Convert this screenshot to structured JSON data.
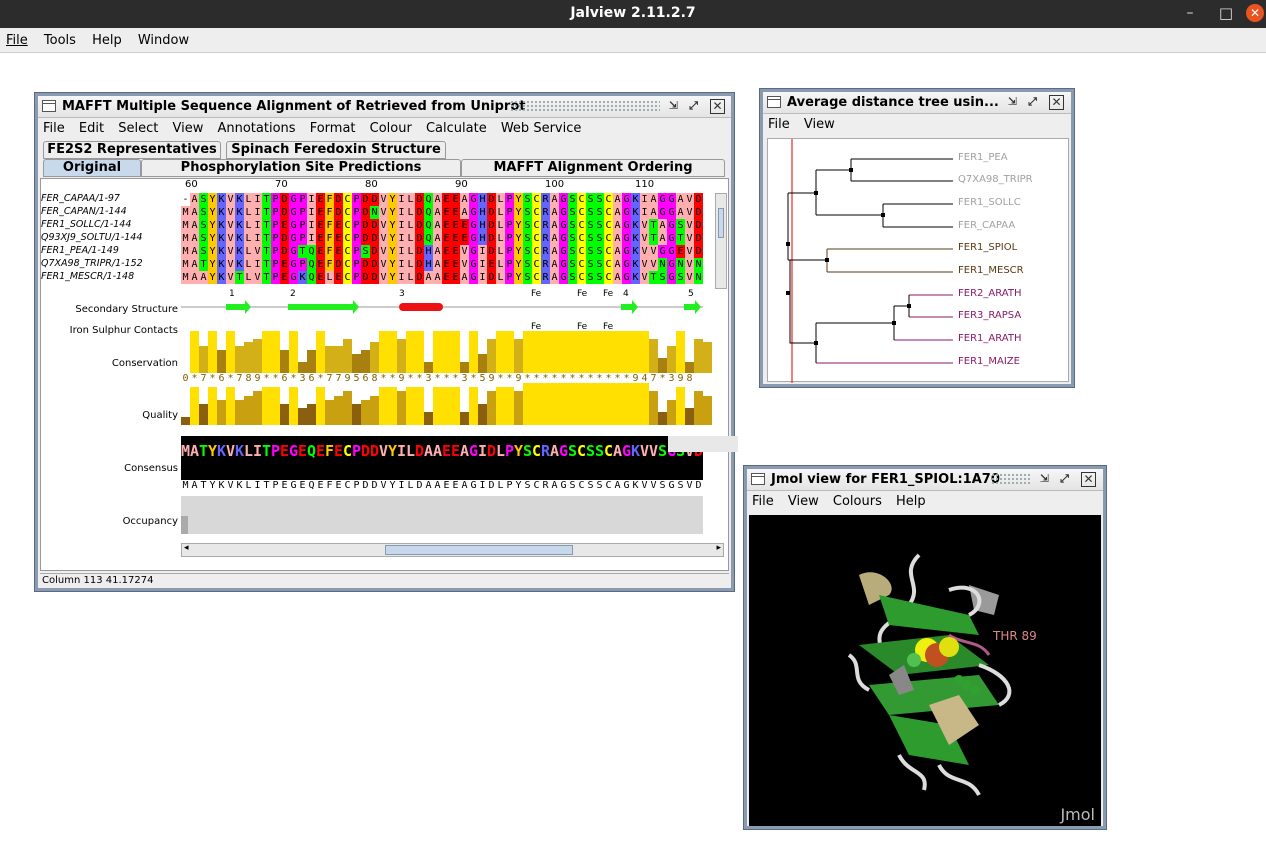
{
  "app": {
    "title": "Jalview 2.11.2.7",
    "menu": [
      "File",
      "Tools",
      "Help",
      "Window"
    ],
    "close_glyph": "✕",
    "minimize_glyph": "–",
    "maximize_glyph": "□"
  },
  "alignment_window": {
    "title": "MAFFT Multiple Sequence Alignment of Retrieved from Uniprot",
    "menu": [
      "File",
      "Edit",
      "Select",
      "View",
      "Annotations",
      "Format",
      "Colour",
      "Calculate",
      "Web Service"
    ],
    "tabs_row1": [
      "FE2S2 Representatives",
      "Spinach Feredoxin Structure"
    ],
    "tabs_row2": [
      "Original",
      "Phosphorylation Site Predictions",
      "MAFFT Alignment Ordering"
    ],
    "ruler": [
      "60",
      "70",
      "80",
      "90",
      "100",
      "110"
    ],
    "sequences": [
      {
        "name": "FER_CAPAA/1-97",
        "seq": "-ASYKVKLITPDGPIEFDCPDDVYILDQAEEAGHDLPYSCRAGSCSSCAGKIAGGAVD"
      },
      {
        "name": "FER_CAPAN/1-144",
        "seq": "MASYKVKLITPDGPIEFDCPDNVYILDQAEEAGHDLPYSCRAGSCSSCAGKIAGGAVD"
      },
      {
        "name": "FER1_SOLLC/1-144",
        "seq": "MASYKVKLITPEGPIEFECPDDVYILDQAEEEGHDLPYSCRAGSCSSCAGKVTAGSVD"
      },
      {
        "name": "Q93XJ9_SOLTU/1-144",
        "seq": "MASYKVKLITPDGPIEFECPDDVYILDQAEEEGHDLPYSCRAGSCSSCAGKVTAGTVD"
      },
      {
        "name": "FER1_PEA/1-149",
        "seq": "MASYKVKLVTPDGTQEFECPSDVYILDHAEEVGIDLPYSCRAGSCSSCAGKVVGGEVD"
      },
      {
        "name": "Q7XA98_TRIPR/1-152",
        "seq": "MATYKVKLITPEGPQEFDCPDDVYILDHAEEVGIELPYSCRAGSCSSCAGKVVNGNVN"
      },
      {
        "name": "FER1_MESCR/1-148",
        "seq": "MAAYKVTLVTPEGKQELECPDDVYILDAAEEAGIDLPYSCRAGSCSSCAGKVTSGSVN"
      }
    ],
    "annotation_labels": [
      "Secondary Structure",
      "Iron Sulphur Contacts",
      "Conservation",
      "Quality",
      "Consensus",
      "Occupancy"
    ],
    "ss_labels": [
      "1",
      "2",
      "3",
      "4",
      "5"
    ],
    "fe_labels": [
      "Fe",
      "Fe",
      "Fe"
    ],
    "conservation_string": "0*7*6*789**6*36*779568**9**3***3*59**9************947*398",
    "conservation_scores": [
      0,
      11,
      7,
      11,
      6,
      11,
      7,
      8,
      9,
      11,
      11,
      6,
      11,
      3,
      6,
      11,
      7,
      7,
      9,
      5,
      6,
      8,
      11,
      11,
      9,
      11,
      11,
      3,
      11,
      11,
      11,
      3,
      11,
      5,
      9,
      11,
      11,
      9,
      11,
      11,
      11,
      11,
      11,
      11,
      11,
      11,
      11,
      11,
      11,
      11,
      11,
      11,
      9,
      4,
      7,
      11,
      3,
      9,
      8
    ],
    "quality_scores": [
      2,
      9,
      5,
      9,
      6,
      9,
      6,
      7,
      8,
      9,
      9,
      5,
      9,
      4,
      5,
      9,
      6,
      7,
      8,
      5,
      6,
      7,
      9,
      9,
      8,
      9,
      9,
      3,
      9,
      9,
      9,
      3,
      9,
      5,
      8,
      9,
      9,
      8,
      10,
      10,
      10,
      10,
      10,
      10,
      10,
      10,
      10,
      10,
      10,
      10,
      10,
      10,
      8,
      3,
      6,
      9,
      4,
      8,
      7
    ],
    "consensus_string": "MATYKVKLITPEGEQEFECPDDVYILDAAEEAGIDLPYSCRAGSCSSCAGKVVSGSVD",
    "status": "Column 113  41.17274"
  },
  "tree_window": {
    "title": "Average distance tree usin...",
    "menu": [
      "File",
      "View"
    ],
    "leaves": [
      {
        "label": "FER1_PEA",
        "color": "#a0a0a0"
      },
      {
        "label": "Q7XA98_TRIPR",
        "color": "#a0a0a0"
      },
      {
        "label": "FER1_SOLLC",
        "color": "#a0a0a0"
      },
      {
        "label": "FER_CAPAA",
        "color": "#a0a0a0"
      },
      {
        "label": "FER1_SPIOL",
        "color": "#5a3a10"
      },
      {
        "label": "FER1_MESCR",
        "color": "#5a3a10"
      },
      {
        "label": "FER2_ARATH",
        "color": "#8a1a6a"
      },
      {
        "label": "FER3_RAPSA",
        "color": "#8a1a6a"
      },
      {
        "label": "FER1_ARATH",
        "color": "#8a1a6a"
      },
      {
        "label": "FER1_MAIZE",
        "color": "#8a1a6a"
      }
    ]
  },
  "jmol_window": {
    "title": "Jmol view for FER1_SPIOL:1A70",
    "menu": [
      "File",
      "View",
      "Colours",
      "Help"
    ],
    "residue_label": "THR 89",
    "watermark": "Jmol"
  }
}
